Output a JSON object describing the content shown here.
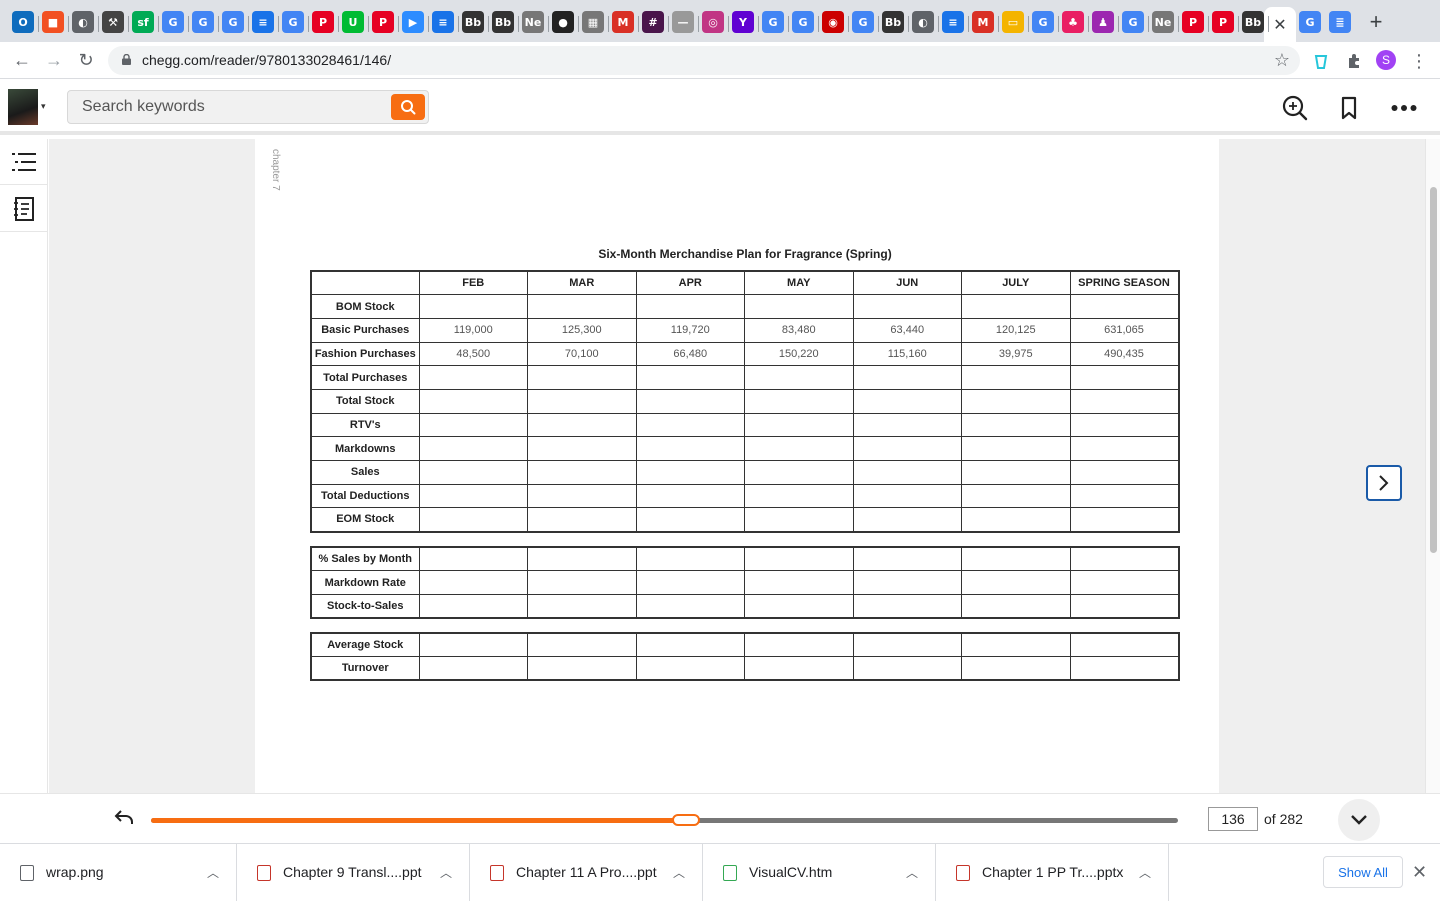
{
  "browser": {
    "tabs": [
      {
        "icon": "outlook-icon",
        "color": "#0f6cbd",
        "glyph": "O"
      },
      {
        "icon": "microsoft-icon",
        "color": "#f25022",
        "glyph": "■"
      },
      {
        "icon": "globe-icon",
        "color": "#5f6368",
        "glyph": "◐"
      },
      {
        "icon": "app-icon",
        "color": "#444",
        "glyph": "⚒"
      },
      {
        "icon": "sf-icon",
        "color": "#0a5",
        "glyph": "sf"
      },
      {
        "icon": "google-icon",
        "color": "#4285f4",
        "glyph": "G"
      },
      {
        "icon": "google-icon",
        "color": "#4285f4",
        "glyph": "G"
      },
      {
        "icon": "google-icon",
        "color": "#4285f4",
        "glyph": "G"
      },
      {
        "icon": "filter-icon",
        "color": "#1a73e8",
        "glyph": "≡"
      },
      {
        "icon": "google-icon",
        "color": "#4285f4",
        "glyph": "G"
      },
      {
        "icon": "pinterest-icon",
        "color": "#e60023",
        "glyph": "P"
      },
      {
        "icon": "app-icon",
        "color": "#0b3",
        "glyph": "U"
      },
      {
        "icon": "pinterest-icon",
        "color": "#e60023",
        "glyph": "P"
      },
      {
        "icon": "zoom-icon",
        "color": "#2d8cff",
        "glyph": "▶"
      },
      {
        "icon": "filter-icon",
        "color": "#1a73e8",
        "glyph": "≡"
      },
      {
        "icon": "blackboard-icon",
        "color": "#333",
        "glyph": "Bb"
      },
      {
        "icon": "blackboard-icon",
        "color": "#333",
        "glyph": "Bb"
      },
      {
        "icon": "netflix-icon",
        "color": "#777",
        "glyph": "Ne"
      },
      {
        "icon": "app-icon",
        "color": "#222",
        "glyph": "●"
      },
      {
        "icon": "chart-icon",
        "color": "#777",
        "glyph": "▦"
      },
      {
        "icon": "gmail-icon",
        "color": "#d93025",
        "glyph": "M"
      },
      {
        "icon": "slack-icon",
        "color": "#4a154b",
        "glyph": "#"
      },
      {
        "icon": "app-icon",
        "color": "#999",
        "glyph": "—"
      },
      {
        "icon": "instagram-icon",
        "color": "#c13584",
        "glyph": "◎"
      },
      {
        "icon": "yahoo-icon",
        "color": "#6001d2",
        "glyph": "Y"
      },
      {
        "icon": "google-icon",
        "color": "#4285f4",
        "glyph": "G"
      },
      {
        "icon": "google-icon",
        "color": "#4285f4",
        "glyph": "G"
      },
      {
        "icon": "target-icon",
        "color": "#cc0000",
        "glyph": "◉"
      },
      {
        "icon": "google-icon",
        "color": "#4285f4",
        "glyph": "G"
      },
      {
        "icon": "blackboard-icon",
        "color": "#333",
        "glyph": "Bb"
      },
      {
        "icon": "globe-icon",
        "color": "#5f6368",
        "glyph": "◐"
      },
      {
        "icon": "filter-icon",
        "color": "#1a73e8",
        "glyph": "≡"
      },
      {
        "icon": "gmail-icon",
        "color": "#d93025",
        "glyph": "M"
      },
      {
        "icon": "slides-icon",
        "color": "#f4b400",
        "glyph": "▭"
      },
      {
        "icon": "google-icon",
        "color": "#4285f4",
        "glyph": "G"
      },
      {
        "icon": "app-icon",
        "color": "#e91e63",
        "glyph": "♣"
      },
      {
        "icon": "app-icon",
        "color": "#9c27b0",
        "glyph": "♟"
      },
      {
        "icon": "google-icon",
        "color": "#4285f4",
        "glyph": "G"
      },
      {
        "icon": "netflix-icon",
        "color": "#777",
        "glyph": "Ne"
      },
      {
        "icon": "pinterest-icon",
        "color": "#e60023",
        "glyph": "P"
      },
      {
        "icon": "pinterest-icon",
        "color": "#e60023",
        "glyph": "P"
      },
      {
        "icon": "blackboard-icon",
        "color": "#333",
        "glyph": "Bb"
      }
    ],
    "after_tabs": [
      {
        "icon": "google-icon",
        "color": "#4285f4",
        "glyph": "G"
      },
      {
        "icon": "docs-icon",
        "color": "#4285f4",
        "glyph": "≣"
      }
    ],
    "url": "chegg.com/reader/9780133028461/146/",
    "profile_initial": "S"
  },
  "app": {
    "search_placeholder": "Search keywords",
    "accent": "#f76d12"
  },
  "document": {
    "chapter_label": "chapter 7",
    "table_title": "Six-Month Merchandise Plan for Fragrance (Spring)",
    "columns": [
      "FEB",
      "MAR",
      "APR",
      "MAY",
      "JUN",
      "JULY",
      "SPRING SEASON"
    ],
    "section1_rows": [
      {
        "label": "BOM Stock",
        "values": [
          "",
          "",
          "",
          "",
          "",
          "",
          ""
        ]
      },
      {
        "label": "Basic Purchases",
        "values": [
          "119,000",
          "125,300",
          "119,720",
          "83,480",
          "63,440",
          "120,125",
          "631,065"
        ]
      },
      {
        "label": "Fashion Purchases",
        "values": [
          "48,500",
          "70,100",
          "66,480",
          "150,220",
          "115,160",
          "39,975",
          "490,435"
        ]
      },
      {
        "label": "Total Purchases",
        "values": [
          "",
          "",
          "",
          "",
          "",
          "",
          ""
        ]
      },
      {
        "label": "Total Stock",
        "values": [
          "",
          "",
          "",
          "",
          "",
          "",
          ""
        ]
      },
      {
        "label": "RTV's",
        "values": [
          "",
          "",
          "",
          "",
          "",
          "",
          ""
        ]
      },
      {
        "label": "Markdowns",
        "values": [
          "",
          "",
          "",
          "",
          "",
          "",
          ""
        ]
      },
      {
        "label": "Sales",
        "values": [
          "",
          "",
          "",
          "",
          "",
          "",
          ""
        ]
      },
      {
        "label": "Total Deductions",
        "values": [
          "",
          "",
          "",
          "",
          "",
          "",
          ""
        ]
      },
      {
        "label": "EOM Stock",
        "values": [
          "",
          "",
          "",
          "",
          "",
          "",
          ""
        ]
      }
    ],
    "section2_rows": [
      {
        "label": "% Sales by Month",
        "values": [
          "",
          "",
          "",
          "",
          "",
          "",
          ""
        ]
      },
      {
        "label": "Markdown Rate",
        "values": [
          "",
          "",
          "",
          "",
          "",
          "",
          ""
        ]
      },
      {
        "label": "Stock-to-Sales",
        "values": [
          "",
          "",
          "",
          "",
          "",
          "",
          ""
        ]
      }
    ],
    "section3_rows": [
      {
        "label": "Average Stock",
        "values": [
          "",
          "",
          "",
          "",
          "",
          "",
          ""
        ]
      },
      {
        "label": "Turnover",
        "values": [
          "",
          "",
          "",
          "",
          "",
          "",
          ""
        ]
      }
    ]
  },
  "pager": {
    "current_page": "136",
    "of_label": "of 282",
    "progress": 0.521
  },
  "downloads": {
    "items": [
      {
        "name": "wrap.png",
        "icon": "image-file-icon",
        "color": "#5f6368"
      },
      {
        "name": "Chapter 9 Transl....ppt",
        "icon": "powerpoint-file-icon",
        "color": "#c5352a"
      },
      {
        "name": "Chapter 11 A Pro....ppt",
        "icon": "powerpoint-file-icon",
        "color": "#c5352a"
      },
      {
        "name": "VisualCV.htm",
        "icon": "chrome-file-icon",
        "color": "#34a853"
      },
      {
        "name": "Chapter 1  PP Tr....pptx",
        "icon": "powerpoint-file-icon",
        "color": "#c5352a"
      }
    ],
    "show_all": "Show All"
  }
}
